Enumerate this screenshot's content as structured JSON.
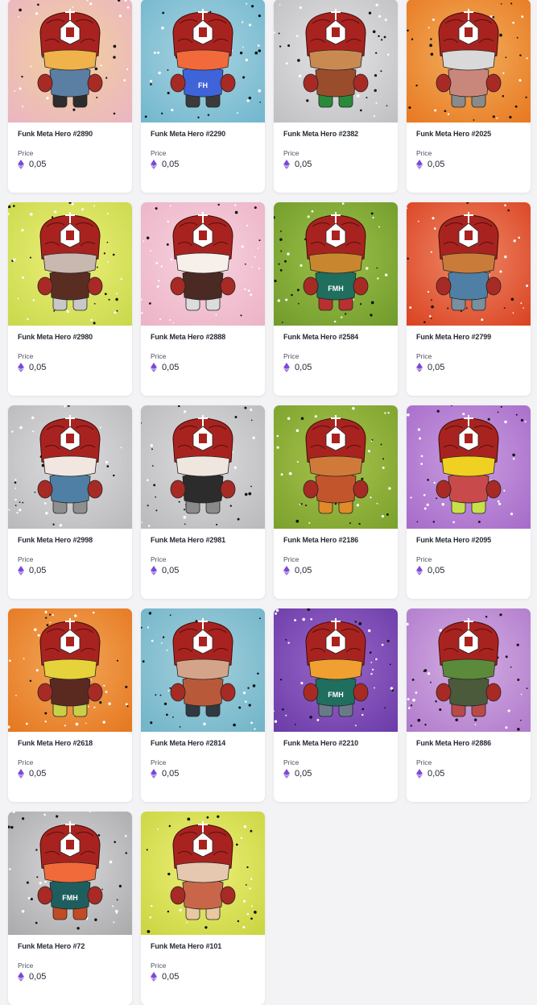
{
  "price_label": "Price",
  "eth_color": "#7b49d6",
  "cards": [
    {
      "name": "Funk Meta Hero #2890",
      "price": "0,05",
      "bg": "#eab4c4",
      "bg2": "#f3d19a",
      "body": "#5b7fa3",
      "legs": "#2d2d2d",
      "visor": "#f0b24a",
      "emblem": ""
    },
    {
      "name": "Funk Meta Hero #2290",
      "price": "0,05",
      "bg": "#70b6ce",
      "bg2": "#a9d4e0",
      "body": "#3f63d8",
      "legs": "#3a3a3a",
      "visor": "#f26a3b",
      "emblem": "FH"
    },
    {
      "name": "Funk Meta Hero #2382",
      "price": "0,05",
      "bg": "#bfbfc2",
      "bg2": "#e4e4e6",
      "body": "#9a4d2c",
      "legs": "#2a8a3a",
      "visor": "#c98a52",
      "emblem": ""
    },
    {
      "name": "Funk Meta Hero #2025",
      "price": "0,05",
      "bg": "#e8771f",
      "bg2": "#f2b060",
      "body": "#c9877b",
      "legs": "#8a8a8a",
      "visor": "#d9d9d9",
      "emblem": ""
    },
    {
      "name": "Funk Meta Hero #2980",
      "price": "0,05",
      "bg": "#c7d84a",
      "bg2": "#eef07a",
      "body": "#5a2d22",
      "legs": "#c8c8c8",
      "visor": "#c9b8b0",
      "emblem": ""
    },
    {
      "name": "Funk Meta Hero #2888",
      "price": "0,05",
      "bg": "#ecb2c6",
      "bg2": "#f6d3df",
      "body": "#4a2a22",
      "legs": "#dcdcdc",
      "visor": "#f7f0ea",
      "emblem": ""
    },
    {
      "name": "Funk Meta Hero #2584",
      "price": "0,05",
      "bg": "#6f9a2a",
      "bg2": "#9ec14a",
      "body": "#1f6e5e",
      "legs": "#b83030",
      "visor": "#c8872e",
      "emblem": "FMH"
    },
    {
      "name": "Funk Meta Hero #2799",
      "price": "0,05",
      "bg": "#d9411f",
      "bg2": "#ef8a6a",
      "body": "#4f7fa5",
      "legs": "#7a8fa0",
      "visor": "#c97c3a",
      "emblem": ""
    },
    {
      "name": "Funk Meta Hero #2998",
      "price": "0,05",
      "bg": "#b8b8bb",
      "bg2": "#dedee0",
      "body": "#4f7fa5",
      "legs": "#8f8f8f",
      "visor": "#f2e6e0",
      "emblem": ""
    },
    {
      "name": "Funk Meta Hero #2981",
      "price": "0,05",
      "bg": "#b9b9bc",
      "bg2": "#dcdcde",
      "body": "#2c2c2c",
      "legs": "#8a8a8a",
      "visor": "#f0e6e0",
      "emblem": ""
    },
    {
      "name": "Funk Meta Hero #2186",
      "price": "0,05",
      "bg": "#7aa02c",
      "bg2": "#a8c44c",
      "body": "#c3552c",
      "legs": "#e08a2a",
      "visor": "#d07a3a",
      "emblem": ""
    },
    {
      "name": "Funk Meta Hero #2095",
      "price": "0,05",
      "bg": "#a66ac9",
      "bg2": "#c99ee0",
      "body": "#c94a4a",
      "legs": "#c8e04a",
      "visor": "#f0d020",
      "emblem": ""
    },
    {
      "name": "Funk Meta Hero #2618",
      "price": "0,05",
      "bg": "#e5761f",
      "bg2": "#f3a85a",
      "body": "#5a2a20",
      "legs": "#c8d048",
      "visor": "#e6d23a",
      "emblem": ""
    },
    {
      "name": "Funk Meta Hero #2814",
      "price": "0,05",
      "bg": "#6fb4c8",
      "bg2": "#a4d0dc",
      "body": "#b85a3a",
      "legs": "#2f3a40",
      "visor": "#d4a48a",
      "emblem": ""
    },
    {
      "name": "Funk Meta Hero #2210",
      "price": "0,05",
      "bg": "#6a3aa8",
      "bg2": "#9a68c8",
      "body": "#1f6e5e",
      "legs": "#6a7a8a",
      "visor": "#f0a030",
      "emblem": "FMH"
    },
    {
      "name": "Funk Meta Hero #2886",
      "price": "0,05",
      "bg": "#b07acc",
      "bg2": "#d4aee2",
      "body": "#4a5a3a",
      "legs": "#b84a4a",
      "visor": "#5a8a3a",
      "emblem": ""
    },
    {
      "name": "Funk Meta Hero #72",
      "price": "0,05",
      "bg": "#a9a9ac",
      "bg2": "#d8d8da",
      "body": "#1f5e5e",
      "legs": "#c24a24",
      "visor": "#f06a3a",
      "emblem": "FMH"
    },
    {
      "name": "Funk Meta Hero #101",
      "price": "0,05",
      "bg": "#c8d43e",
      "bg2": "#eef07a",
      "body": "#c9664a",
      "legs": "#e8c8a0",
      "visor": "#e6c8b0",
      "emblem": ""
    }
  ]
}
